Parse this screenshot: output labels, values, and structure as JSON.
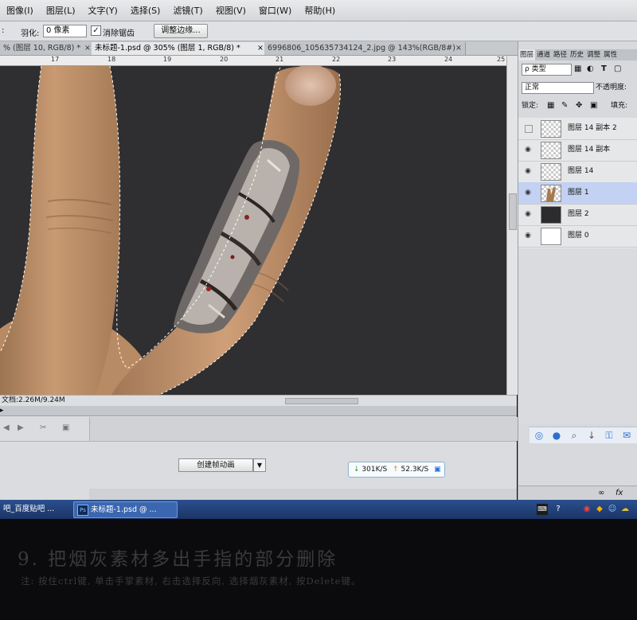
{
  "menu": [
    "图像(I)",
    "图层(L)",
    "文字(Y)",
    "选择(S)",
    "滤镜(T)",
    "视图(V)",
    "窗口(W)",
    "帮助(H)"
  ],
  "options": {
    "feather_label": "羽化:",
    "feather_value": "0 像素",
    "antialias_label": "消除锯齿",
    "refine_edge_label": "调整边缘..."
  },
  "tabs": [
    {
      "label": "% (图层 10, RGB/8) *",
      "close": "×"
    },
    {
      "label": "未标题-1.psd @ 305% (图层 1, RGB/8) *",
      "close": "×"
    },
    {
      "label": "6996806_105635734124_2.jpg @ 143%(RGB/8#)",
      "close": "×"
    }
  ],
  "ruler": [
    "17",
    "18",
    "19",
    "20",
    "21",
    "22",
    "23",
    "24",
    "25"
  ],
  "status": {
    "doc": "文档:2.26M/9.24M"
  },
  "timeline": {
    "create_label": "创建帧动画",
    "net_down": "301K/S",
    "net_up": "52.3K/S"
  },
  "panel": {
    "tabs": [
      "图层",
      "通道",
      "路径",
      "历史",
      "调整",
      "属性"
    ],
    "kind_label": "ρ 类型",
    "blend_mode": "正常",
    "opacity_label": "不透明度:",
    "lock_label": "锁定:",
    "fill_label": "填充:",
    "layers": [
      {
        "name": "图层 14 副本 2",
        "visible": false
      },
      {
        "name": "图层 14 副本",
        "visible": true
      },
      {
        "name": "图层 14",
        "visible": true
      },
      {
        "name": "图层 1",
        "visible": true,
        "selected": true
      },
      {
        "name": "图层 2",
        "visible": true
      },
      {
        "name": "图层 0",
        "visible": true
      }
    ]
  },
  "taskbar": {
    "task1": "吧_百度贴吧 ...",
    "task2": "未标题-1.psd @ ..."
  },
  "caption": {
    "title": "9. 把烟灰素材多出手指的部分删除",
    "note": "注: 按住ctrl键, 单击手掌素材, 右击选择反向, 选择烟灰素材, 按Delete键。"
  }
}
